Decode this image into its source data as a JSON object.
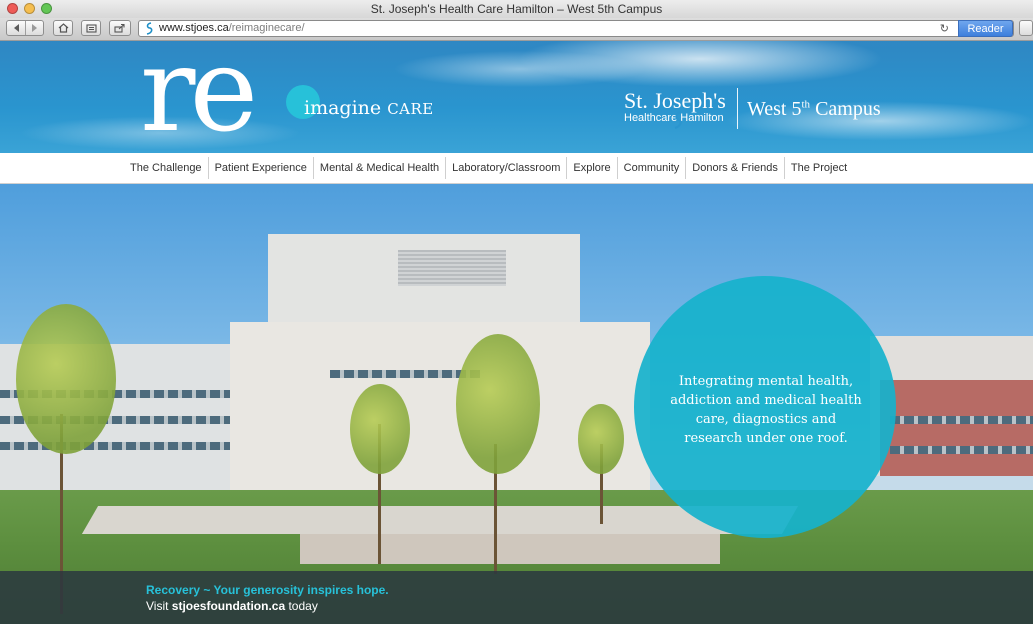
{
  "window": {
    "title": "St. Joseph's Health Care Hamilton – West 5th Campus"
  },
  "toolbar": {
    "url_domain": "www.stjoes.ca",
    "url_path": "/reimaginecare/",
    "reader_label": "Reader"
  },
  "header": {
    "logo_re": "re",
    "logo_imagine": "imagine",
    "logo_care": "CARE",
    "org_name": "St. Joseph's",
    "org_sub": "Healthcare Hamilton",
    "campus": "West 5",
    "campus_sup": "th",
    "campus_suffix": " Campus"
  },
  "nav": {
    "items": [
      "The Challenge",
      "Patient Experience",
      "Mental & Medical Health",
      "Laboratory/Classroom",
      "Explore",
      "Community",
      "Donors & Friends",
      "The Project"
    ]
  },
  "hero": {
    "circle_text": "Integrating mental health, addiction and medical health care, diagnostics and research under one roof."
  },
  "footer": {
    "tagline": "Recovery ~ Your generosity inspires hope.",
    "visit_prefix": "Visit ",
    "visit_link": "stjoesfoundation.ca",
    "visit_suffix": " today"
  },
  "colors": {
    "accent_teal": "#27c1d9",
    "circle": "#16b2cc",
    "header_blue": "#2a95cf"
  }
}
